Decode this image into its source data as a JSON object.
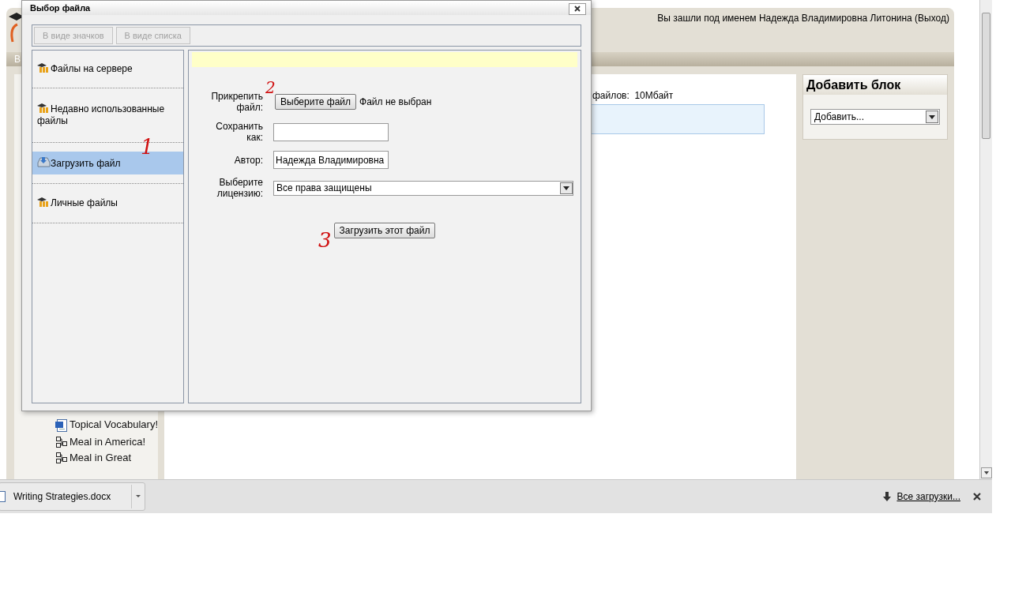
{
  "page": {
    "user_info": "Вы зашли под именем Надежда Владимировна Литонина (Выход)",
    "nav_fragment": "В",
    "left_block": {
      "items": [
        {
          "kind": "document",
          "label": "Topical Vocabulary!"
        },
        {
          "kind": "activity",
          "label": "Meal in America!"
        },
        {
          "kind": "activity",
          "label": "Meal in Great"
        }
      ]
    },
    "main": {
      "max_size_fragment": "файлов:  10Мбайт"
    },
    "add_block": {
      "title": "Добавить блок",
      "select": "Добавить..."
    }
  },
  "dialog": {
    "title": "Выбор файла",
    "view_buttons": [
      {
        "label": "В виде значков",
        "disabled": true
      },
      {
        "label": "В виде списка",
        "disabled": true
      }
    ],
    "sources": [
      {
        "kind": "repository",
        "label": "Файлы на сервере",
        "selected": false
      },
      {
        "kind": "repository",
        "label": "Недавно использованные файлы",
        "selected": false
      },
      {
        "kind": "upload",
        "label": "Загрузить файл",
        "selected": true
      },
      {
        "kind": "repository",
        "label": "Личные файлы",
        "selected": false
      }
    ],
    "form": {
      "attach_label": "Прикрепить файл:",
      "choose_button": "Выберите файл",
      "file_status": "Файл не выбран",
      "save_as_label": "Сохранить как:",
      "author_label": "Автор:",
      "author_value": "Надежда Владимировна",
      "license_label": "Выберите лицензию:",
      "license_value": "Все права защищены",
      "upload_button": "Загрузить этот файл"
    },
    "annotations": [
      "1",
      "2",
      "3"
    ]
  },
  "downloads": {
    "file": "Writing Strategies.docx",
    "all_link": "Все загрузки..."
  }
}
